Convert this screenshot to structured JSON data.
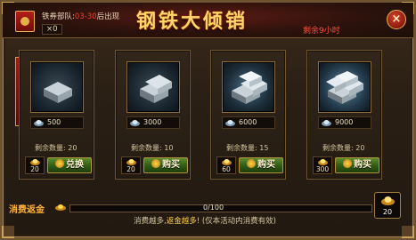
{
  "header": {
    "title": "钢铁大倾销",
    "coupon_label_prefix": "铁券部队:",
    "coupon_label_red": "03-30",
    "coupon_label_suffix": "后出现",
    "coupon_count": "×0",
    "remain_time": "剩余9小时",
    "close_label": "×"
  },
  "side_tag": {
    "label": "全部"
  },
  "cards": [
    {
      "price": "500",
      "stock": "剩余数量: 20",
      "cost": "20",
      "button": "兑换",
      "glow": "none"
    },
    {
      "price": "3000",
      "stock": "剩余数量: 10",
      "cost": "20",
      "button": "购买",
      "glow": "none"
    },
    {
      "price": "6000",
      "stock": "剩余数量: 15",
      "cost": "60",
      "button": "购买",
      "glow": "glow"
    },
    {
      "price": "9000",
      "stock": "剩余数量: 20",
      "cost": "300",
      "button": "购买",
      "glow": "glow2"
    }
  ],
  "progress": {
    "label": "消费返金",
    "value": "0/100",
    "fraction": 0,
    "note_prefix": "消费越多,",
    "note_hl": "返金越多",
    "note_suffix": "! (仅本活动内消费有效)",
    "reward": "20"
  },
  "colors": {
    "title": "#ffd76a",
    "highlight_red": "#ff3b2e",
    "buy_green": "#3a6a1a",
    "gold": "#f0c14a"
  }
}
